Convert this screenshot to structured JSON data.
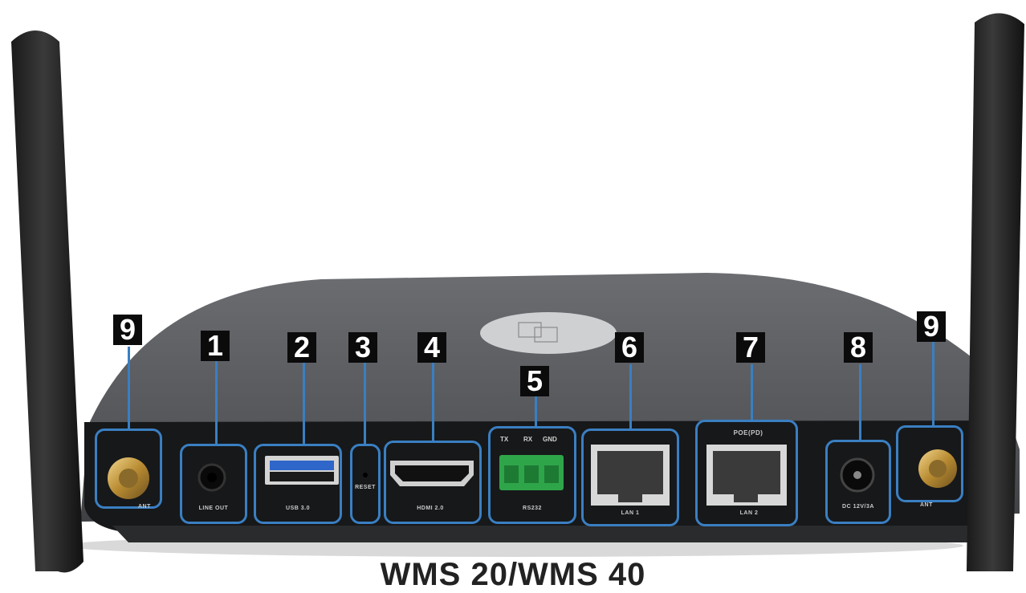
{
  "product_caption": "WMS 20/WMS 40",
  "callouts": [
    {
      "number": "1",
      "port_label": "LINE OUT"
    },
    {
      "number": "2",
      "port_label": "USB 3.0"
    },
    {
      "number": "3",
      "port_label": "RESET"
    },
    {
      "number": "4",
      "port_label": "HDMI 2.0"
    },
    {
      "number": "5",
      "port_label": "RS232"
    },
    {
      "number": "6",
      "port_label": "LAN 1"
    },
    {
      "number": "7",
      "port_label": "LAN 2"
    },
    {
      "number": "8",
      "port_label": "DC 12V/3A"
    },
    {
      "number": "9",
      "port_label": "ANT"
    }
  ],
  "rs232_pins": [
    "TX",
    "RX",
    "GND"
  ],
  "poe_label": "POE(PD)",
  "colors": {
    "callout_border": "#3a7fc2",
    "badge_bg": "#0b0b0b",
    "badge_text": "#ffffff",
    "device_body": "#5a5c60",
    "rear_panel": "#17181a",
    "terminal_green": "#2fa54a"
  }
}
